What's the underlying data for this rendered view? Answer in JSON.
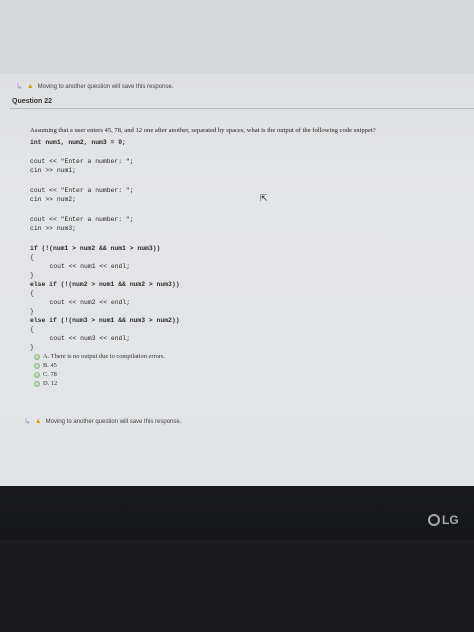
{
  "warning_top": "Moving to another question will save this response.",
  "question": {
    "title": "Question 22",
    "prompt": "Assuming that a user enters 45, 78, and 12 one after another, separated by spaces, what is the output of the following code snippet?"
  },
  "code_lines": [
    "int num1, num2, num3 = 0;",
    "cout << \"Enter a number: \";",
    "cin >> num1;",
    "cout << \"Enter a number: \";",
    "cin >> num2;",
    "cout << \"Enter a number: \";",
    "cin >> num3;",
    "if (!(num1 > num2 && num1 > num3))",
    "{",
    "   cout << num1 << endl;",
    "}",
    "else if (!(num2 > num1 && num2 > num3))",
    "{",
    "   cout << num2 << endl;",
    "}",
    "else if (!(num3 > num1 && num3 > num2))",
    "{",
    "   cout << num3 << endl;",
    "}"
  ],
  "options": [
    "A. There is no output due to compilation errors.",
    "B. 45",
    "C. 78",
    "D. 12"
  ],
  "warning_bottom": "Moving to another question will save this response.",
  "monitor_brand": "LG"
}
